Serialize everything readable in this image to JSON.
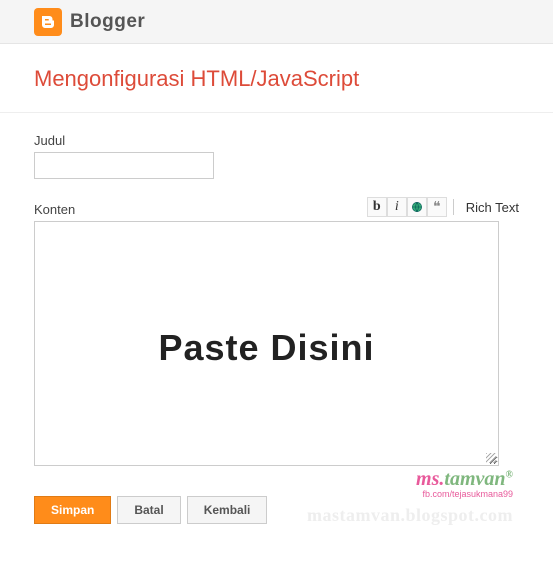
{
  "header": {
    "brand": "Blogger"
  },
  "page": {
    "title": "Mengonfigurasi HTML/JavaScript"
  },
  "form": {
    "title_label": "Judul",
    "title_value": "",
    "content_label": "Konten",
    "richtext_label": "Rich Text",
    "overlay": "Paste Disini"
  },
  "buttons": {
    "save": "Simpan",
    "cancel": "Batal",
    "back": "Kembali"
  },
  "watermark": {
    "prefix": "ms.",
    "main": "tamvan",
    "reg": "®",
    "sub": "fb.com/tejasukmana99",
    "url": "mastamvan.blogspot.com"
  }
}
